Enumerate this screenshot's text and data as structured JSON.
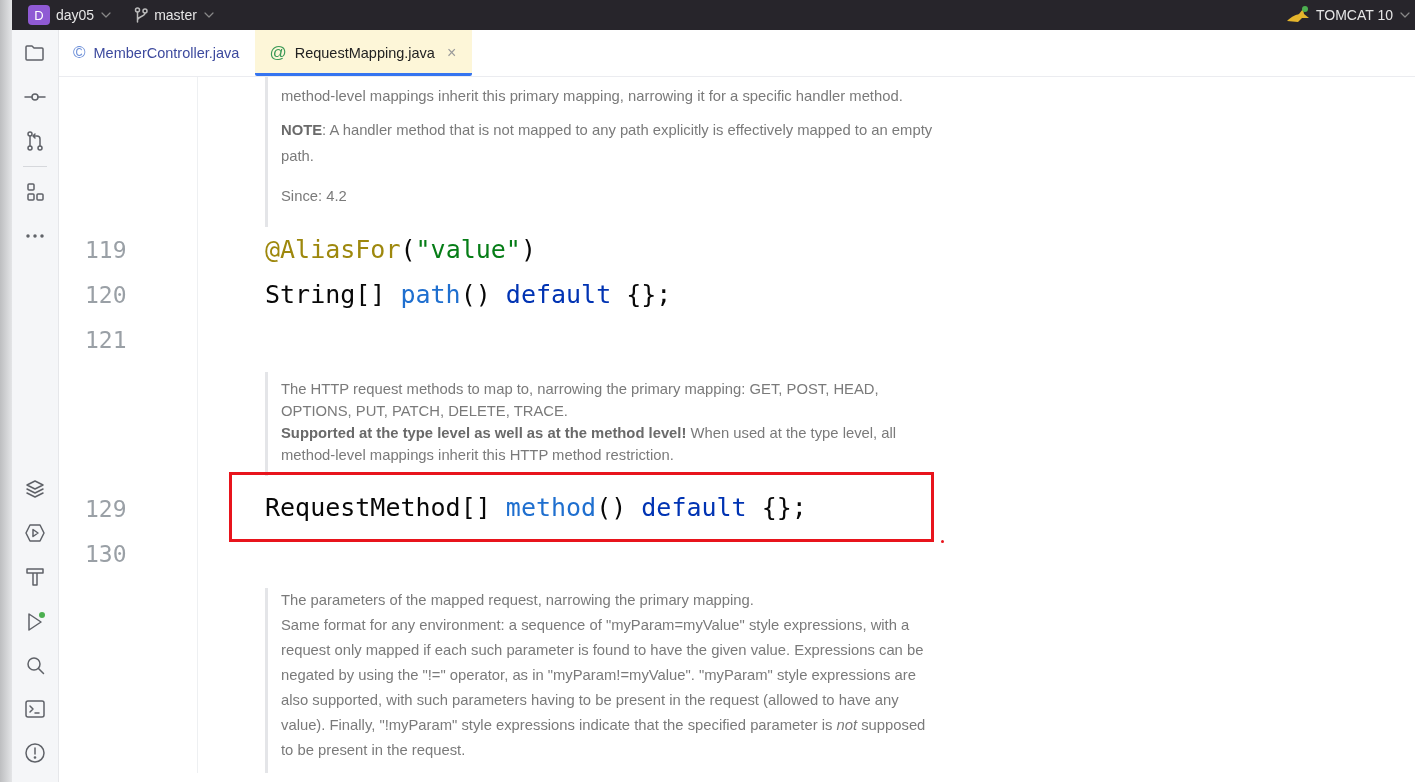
{
  "title_bar": {
    "project": {
      "badge": "D",
      "name": "day05"
    },
    "branch": "master",
    "run_config": "TOMCAT 10"
  },
  "tabs": [
    {
      "label": "MemberController.java",
      "icon": "©",
      "selected": false,
      "closable": false
    },
    {
      "label": "RequestMapping.java",
      "icon": "@",
      "selected": true,
      "closable": true,
      "close": "×"
    }
  ],
  "editor": {
    "items": [
      {
        "kind": "doc",
        "paragraphs": [
          "method-level mappings inherit this primary mapping, narrowing it for a specific handler method.",
          "**NOTE**: A handler method that is not mapped to any path explicitly is effectively mapped to an empty path."
        ],
        "since": "Since: 4.2"
      },
      {
        "kind": "code",
        "number": "119",
        "highlighted": false,
        "tokens": [
          {
            "kind": "annotation",
            "text": "@AliasFor"
          },
          {
            "kind": "plain",
            "text": "("
          },
          {
            "kind": "string",
            "text": "\"value\""
          },
          {
            "kind": "plain",
            "text": ")"
          }
        ]
      },
      {
        "kind": "code",
        "number": "120",
        "highlighted": false,
        "tokens": [
          {
            "kind": "plain",
            "text": "String[] "
          },
          {
            "kind": "method",
            "text": "path"
          },
          {
            "kind": "plain",
            "text": "() "
          },
          {
            "kind": "keyword",
            "text": "default"
          },
          {
            "kind": "plain",
            "text": " {};"
          }
        ]
      },
      {
        "kind": "code",
        "number": "121",
        "highlighted": false
      },
      {
        "kind": "doc",
        "paragraphs": [
          "The HTTP request methods to map to, narrowing the primary mapping: GET, POST, HEAD, OPTIONS, PUT, PATCH, DELETE, TRACE.",
          "**Supported at the type level as well as at the method level!** When used at the type level, all method-level mappings inherit this HTTP method restriction."
        ]
      },
      {
        "kind": "code",
        "number": "129",
        "highlighted": true,
        "tokens": [
          {
            "kind": "plain",
            "text": "RequestMethod[] "
          },
          {
            "kind": "method",
            "text": "method"
          },
          {
            "kind": "plain",
            "text": "() "
          },
          {
            "kind": "keyword",
            "text": "default"
          },
          {
            "kind": "plain",
            "text": " {};"
          }
        ]
      },
      {
        "kind": "code",
        "number": "130",
        "highlighted": false
      },
      {
        "kind": "doc",
        "paragraphs": [
          "The parameters of the mapped request, narrowing the primary mapping.",
          "Same format for any environment: a sequence of \"myParam=myValue\" style expressions, with a request only mapped if each such parameter is found to have the given value. Expressions can be negated by using the \"!=\" operator, as in \"myParam!=myValue\". \"myParam\" style expressions are also supported, with such parameters having to be present in the request (allowed to have any value). Finally, \"!myParam\" style expressions indicate that the specified parameter is *not* supposed to be present in the request."
        ]
      }
    ]
  }
}
